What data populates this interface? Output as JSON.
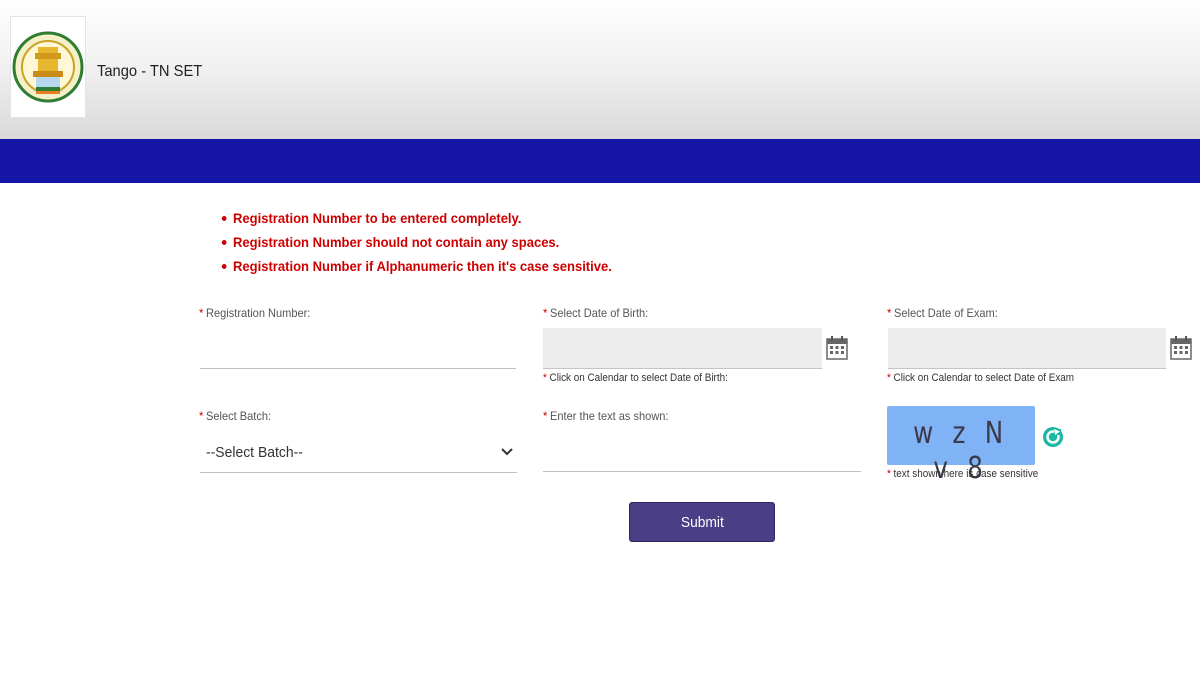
{
  "header": {
    "app_title": "Tango - TN SET"
  },
  "instructions": [
    "Registration Number to be entered completely.",
    "Registration Number should not contain any spaces.",
    "Registration Number if Alphanumeric then it's case sensitive."
  ],
  "form": {
    "required_marker": "*",
    "registration_number": {
      "label": "Registration Number:",
      "value": ""
    },
    "date_of_birth": {
      "label": "Select Date of Birth:",
      "value": "",
      "hint": "Click on Calendar to select Date of Birth:",
      "icon": "calendar-icon"
    },
    "date_of_exam": {
      "label": "Select Date of Exam:",
      "value": "",
      "hint": "Click on Calendar to select Date of Exam",
      "icon": "calendar-icon"
    },
    "batch": {
      "label": "Select Batch:",
      "selected": "--Select Batch--",
      "icon": "chevron-down-icon"
    },
    "captcha_input": {
      "label": "Enter the text as shown:",
      "value": ""
    },
    "captcha": {
      "text": "w z N v 8",
      "hint": "text shown here is case sensitive",
      "background_color": "#7fb3f5",
      "refresh_icon": "refresh-icon",
      "refresh_color": "#1cb7a4"
    },
    "submit_label": "Submit"
  },
  "colors": {
    "nav_band": "#1515a8",
    "instruction_text": "#cc0000",
    "submit_button": "#4a3f86"
  }
}
